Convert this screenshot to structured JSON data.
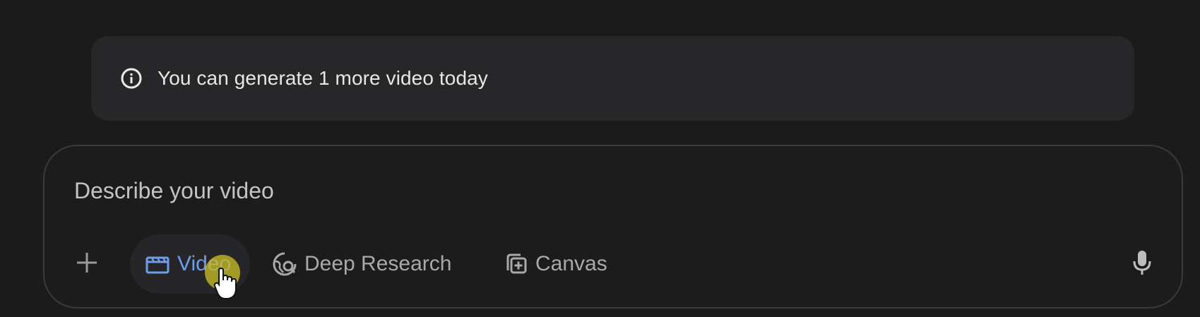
{
  "notice": {
    "icon": "info-icon",
    "text": "You can generate 1 more video today"
  },
  "composer": {
    "placeholder": "Describe your video",
    "value": "",
    "add_icon": "plus-icon",
    "mic_icon": "microphone-icon",
    "tools": [
      {
        "label": "Video",
        "icon": "clapperboard-icon",
        "active": true
      },
      {
        "label": "Deep Research",
        "icon": "globe-search-icon",
        "active": false
      },
      {
        "label": "Canvas",
        "icon": "canvas-add-icon",
        "active": false
      }
    ]
  },
  "colors": {
    "background": "#1b1b1b",
    "notice_bg": "#272729",
    "active_tool": "#6e9ee9",
    "inactive_tool": "#a9a9a9",
    "cursor_highlight": "#c5ba28"
  }
}
